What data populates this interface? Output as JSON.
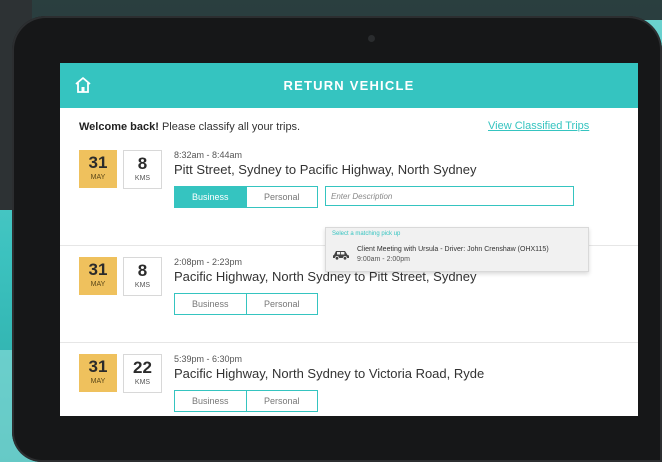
{
  "header": {
    "title": "RETURN VEHICLE"
  },
  "welcome": {
    "bold": "Welcome back!",
    "rest": "Please classify all your trips."
  },
  "view_link": "View Classified Trips",
  "segment": {
    "business": "Business",
    "personal": "Personal"
  },
  "description_placeholder": "Enter Description",
  "trips": [
    {
      "day": "31",
      "month": "MAY",
      "km": "8",
      "km_unit": "KMS",
      "time": "8:32am - 8:44am",
      "route": "Pitt Street, Sydney to Pacific Highway, North Sydney",
      "selected": "Business"
    },
    {
      "day": "31",
      "month": "MAY",
      "km": "8",
      "km_unit": "KMS",
      "time": "2:08pm - 2:23pm",
      "route": "Pacific Highway, North Sydney to Pitt Street, Sydney",
      "selected": ""
    },
    {
      "day": "31",
      "month": "MAY",
      "km": "22",
      "km_unit": "KMS",
      "time": "5:39pm - 6:30pm",
      "route": "Pacific Highway, North Sydney to Victoria Road, Ryde",
      "selected": ""
    }
  ],
  "dropdown": {
    "hint": "Select a matching pick up",
    "title": "Client Meeting with Ursula - Driver: John Crenshaw (OHX115)",
    "time": "9:00am - 2:00pm"
  },
  "colors": {
    "accent": "#35c4c0",
    "date_badge": "#efc15d"
  }
}
